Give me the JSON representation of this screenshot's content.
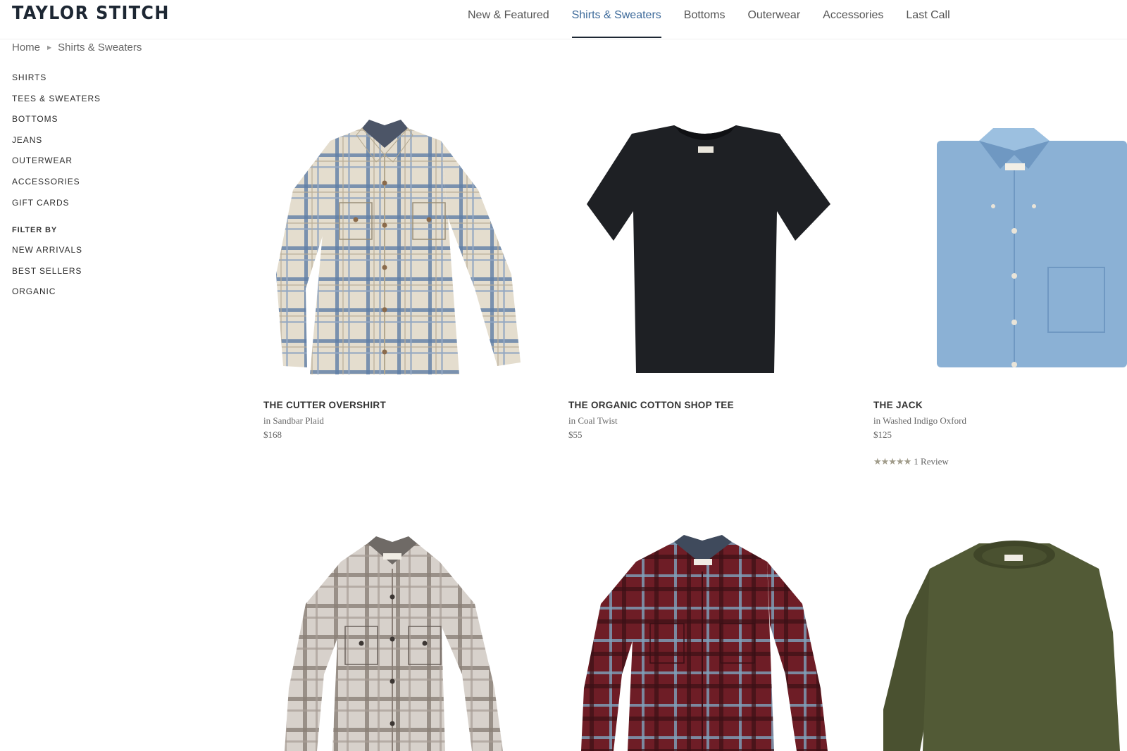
{
  "brand": {
    "logo": "TAYLOR STITCH"
  },
  "nav": {
    "items": [
      {
        "label": "New & Featured",
        "active": false
      },
      {
        "label": "Shirts & Sweaters",
        "active": true
      },
      {
        "label": "Bottoms",
        "active": false
      },
      {
        "label": "Outerwear",
        "active": false
      },
      {
        "label": "Accessories",
        "active": false
      },
      {
        "label": "Last Call",
        "active": false
      }
    ]
  },
  "breadcrumb": {
    "home": "Home",
    "current": "Shirts & Sweaters"
  },
  "sidebar": {
    "categories": [
      "SHIRTS",
      "TEES & SWEATERS",
      "BOTTOMS",
      "JEANS",
      "OUTERWEAR",
      "ACCESSORIES",
      "GIFT CARDS"
    ],
    "filter_title": "FILTER BY",
    "filters": [
      "NEW ARRIVALS",
      "BEST SELLERS",
      "ORGANIC"
    ]
  },
  "products": [
    {
      "name": "THE CUTTER OVERSHIRT",
      "color": "in Sandbar Plaid",
      "price": "$168",
      "image": "plaid-overshirt-image"
    },
    {
      "name": "THE ORGANIC COTTON SHOP TEE",
      "color": "in Coal Twist",
      "price": "$55",
      "image": "black-tee-image"
    },
    {
      "name": "THE JACK",
      "color": "in Washed Indigo Oxford",
      "price": "$125",
      "rating": {
        "stars": 5,
        "text": "1 Review"
      },
      "image": "blue-oxford-shirt-image"
    },
    {
      "name": "",
      "color": "",
      "price": "",
      "image": "grey-plaid-shirt-image"
    },
    {
      "name": "",
      "color": "",
      "price": "",
      "image": "red-plaid-shirt-image"
    },
    {
      "name": "",
      "color": "",
      "price": "",
      "image": "olive-sweater-image"
    }
  ],
  "colors": {
    "brand": "#1d2733",
    "nav_active": "#3d6a9a",
    "star": "#a19c8b"
  }
}
